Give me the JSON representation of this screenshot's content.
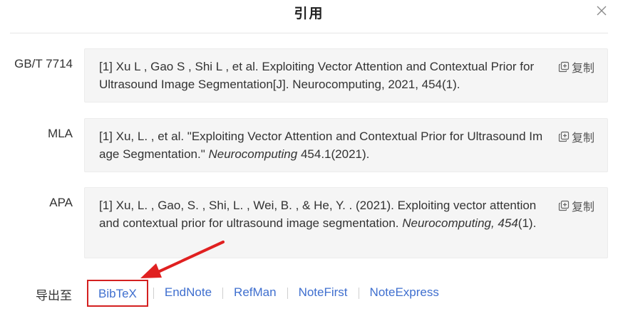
{
  "dialog": {
    "title": "引用",
    "close_icon": "close-icon"
  },
  "citations": [
    {
      "format": "GB/T 7714",
      "segments": [
        {
          "text": "[1] Xu L , Gao S , Shi L , et al. Exploiting Vector Attention and Contextual Prior for Ultrasound Image Segmentation[J]. Neurocomputing, 2021, 454(1).",
          "italic": false
        }
      ],
      "copy_label": "复制"
    },
    {
      "format": "MLA",
      "segments": [
        {
          "text": "[1] Xu, L. , et al. \"Exploiting Vector Attention and Contextual Prior for Ultrasound Image Segmentation.\" ",
          "italic": false
        },
        {
          "text": "Neurocomputing",
          "italic": true
        },
        {
          "text": " 454.1(2021).",
          "italic": false
        }
      ],
      "copy_label": "复制"
    },
    {
      "format": "APA",
      "segments": [
        {
          "text": "[1] Xu, L. , Gao, S. , Shi, L. , Wei, B. , & He, Y. . (2021). Exploiting vector attention and contextual prior for ultrasound image segmentation. ",
          "italic": false
        },
        {
          "text": "Neurocomputing, 454",
          "italic": true
        },
        {
          "text": "(1).",
          "italic": false
        }
      ],
      "copy_label": "复制"
    }
  ],
  "export": {
    "label": "导出至",
    "options": [
      "BibTeX",
      "EndNote",
      "RefMan",
      "NoteFirst",
      "NoteExpress"
    ],
    "highlighted": "BibTeX"
  },
  "colors": {
    "link": "#3f6fcf",
    "highlight_box": "#d42020",
    "arrow": "#e02020",
    "citation_bg": "#f5f5f5"
  }
}
